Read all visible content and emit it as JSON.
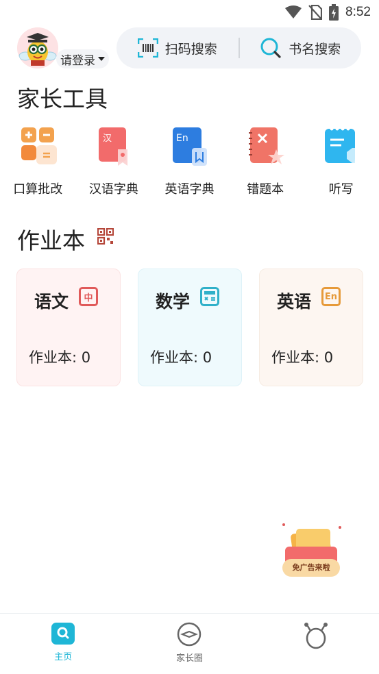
{
  "status_bar": {
    "time": "8:52"
  },
  "header": {
    "login_label": "请登录",
    "scan_search_label": "扫码搜索",
    "title_search_label": "书名搜索"
  },
  "parent_tools": {
    "title": "家长工具",
    "items": [
      {
        "label": "口算批改",
        "icon": "arithmetic-check-icon"
      },
      {
        "label": "汉语字典",
        "icon": "chinese-dictionary-icon"
      },
      {
        "label": "英语字典",
        "icon": "english-dictionary-icon"
      },
      {
        "label": "错题本",
        "icon": "mistake-book-icon"
      },
      {
        "label": "听写",
        "icon": "dictation-icon"
      }
    ]
  },
  "homework": {
    "title": "作业本",
    "cards": [
      {
        "subject": "语文",
        "badge": "中",
        "count_text": "作业本: 0",
        "bg": "#fff3f3",
        "accent": "#e05a5a"
      },
      {
        "subject": "数学",
        "badge": "",
        "count_text": "作业本: 0",
        "bg": "#effafd",
        "accent": "#2fb0c9"
      },
      {
        "subject": "英语",
        "badge": "En",
        "count_text": "作业本: 0",
        "bg": "#fdf6f1",
        "accent": "#e69a3a"
      }
    ]
  },
  "promo": {
    "label": "免广告来啦"
  },
  "tab_bar": {
    "items": [
      {
        "label": "主页",
        "active": true
      },
      {
        "label": "家长圈",
        "active": false
      },
      {
        "label": "",
        "active": false
      }
    ],
    "active_color": "#1fb6d6"
  }
}
